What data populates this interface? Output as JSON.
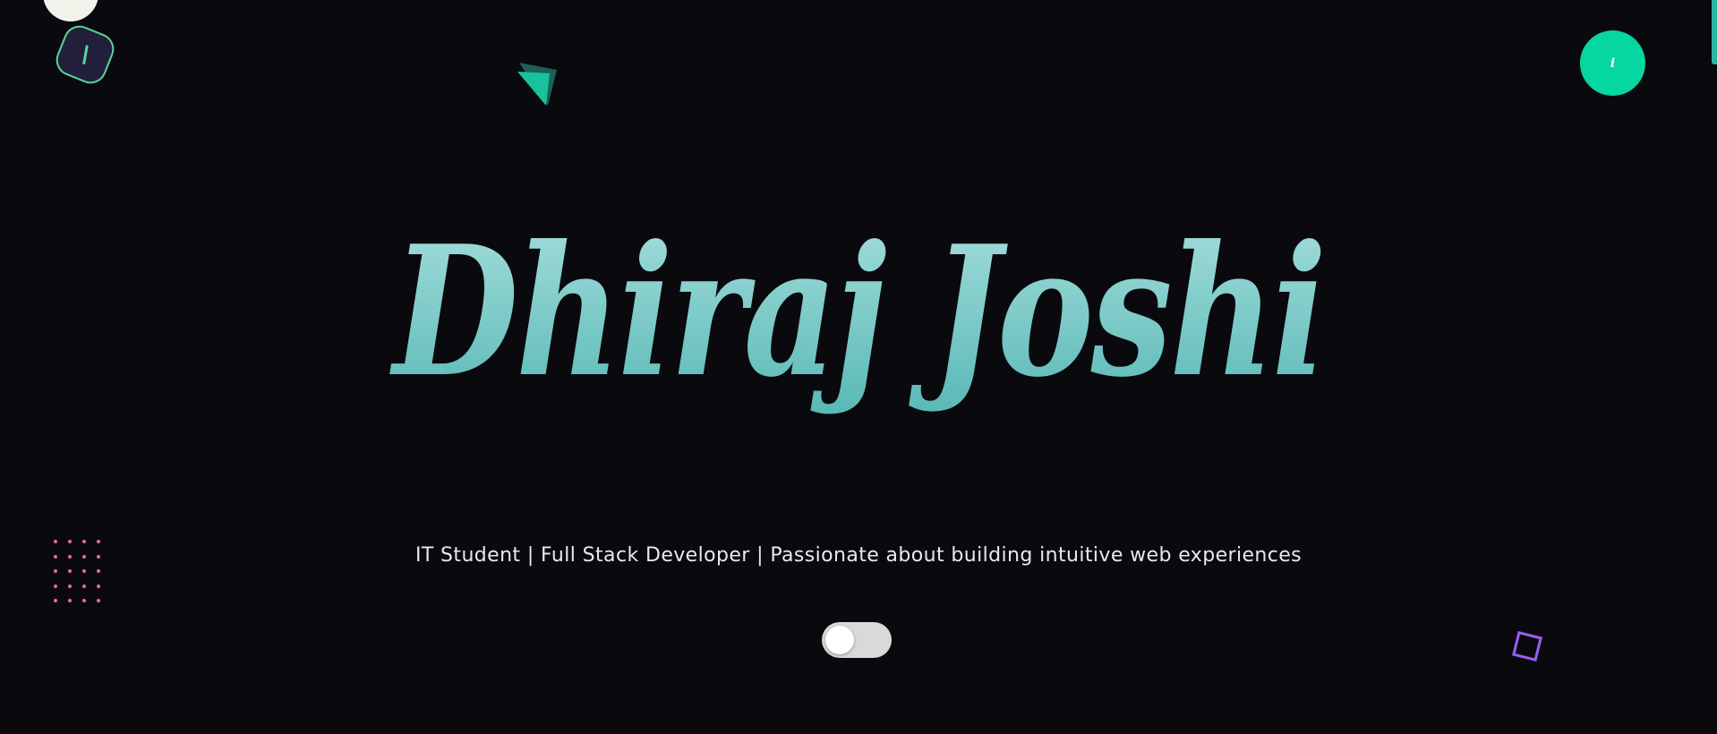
{
  "hero": {
    "name": "Dhiraj Joshi",
    "subtitle": "IT Student | Full Stack Developer | Passionate about building intuitive web experiences"
  },
  "info_button": {
    "label": "i"
  },
  "icons": {
    "badge": "slash-badge-icon",
    "info": "info-icon",
    "triangle": "triangle-decoration",
    "square": "square-decoration",
    "dots": "dot-grid-decoration"
  },
  "theme_toggle": {
    "state": "off"
  },
  "colors": {
    "background": "#0a0a0e",
    "accent_green": "#06d6a0",
    "title_gradient_top": "#a6dfdd",
    "title_gradient_bottom": "#58b8b5",
    "dots": "#f06b7e",
    "square": "#9b5cf6",
    "badge_bg": "#221f3b",
    "badge_border": "#59d49a"
  }
}
